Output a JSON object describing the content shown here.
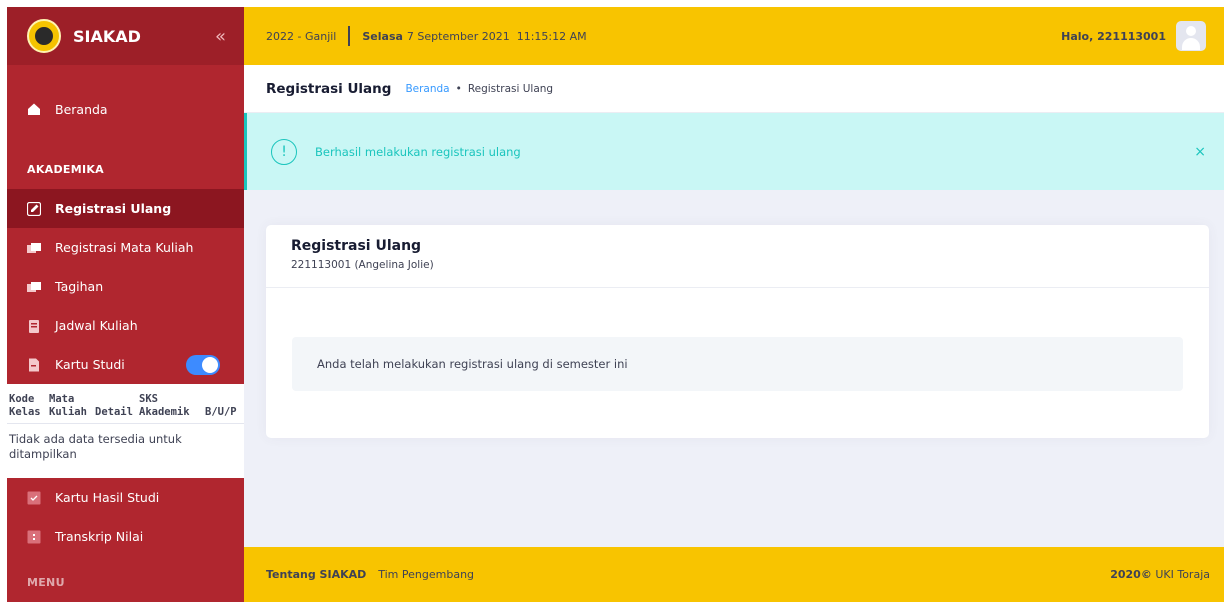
{
  "brand": {
    "name": "SIAKAD",
    "collapse_icon": "chevrons-left-icon"
  },
  "sidebar": {
    "home": {
      "label": "Beranda",
      "icon": "home-icon"
    },
    "section_akademika": "AKADEMIKA",
    "items": [
      {
        "label": "Registrasi Ulang",
        "icon": "edit-icon",
        "active": true
      },
      {
        "label": "Registrasi Mata Kuliah",
        "icon": "book-icon"
      },
      {
        "label": "Tagihan",
        "icon": "book-icon"
      },
      {
        "label": "Jadwal Kuliah",
        "icon": "clipboard-icon"
      },
      {
        "label": "Kartu Studi",
        "icon": "file-icon",
        "toggle_on": true
      },
      {
        "label": "Kartu Hasil Studi",
        "icon": "check-icon"
      },
      {
        "label": "Transkrip Nilai",
        "icon": "transcript-icon"
      }
    ],
    "studi_table": {
      "headers": [
        "Kode Kelas",
        "Mata Kuliah",
        "Detail",
        "SKS Akademik",
        "B/U/P"
      ],
      "empty": "Tidak ada data tersedia untuk ditampilkan"
    },
    "next_section": "MENU"
  },
  "topbar": {
    "semester": "2022 - Ganjil",
    "day": "Selasa",
    "datetime": "7 September 2021  11:15:12 AM",
    "greeting": "Halo, 221113001",
    "avatar_icon": "user-avatar-icon"
  },
  "subheader": {
    "title": "Registrasi Ulang",
    "breadcrumb_home": "Beranda",
    "breadcrumb_current": "Registrasi Ulang"
  },
  "alert": {
    "message": "Berhasil melakukan registrasi ulang",
    "icon": "exclamation-circle-icon",
    "close": "×"
  },
  "card": {
    "title": "Registrasi Ulang",
    "subtitle": "221113001 (Angelina Jolie)",
    "info": "Anda telah melakukan registrasi ulang di semester ini"
  },
  "footer": {
    "link_about": "Tentang SIAKAD",
    "link_team": "Tim Pengembang",
    "year": "2020©",
    "org": "UKI Toraja"
  },
  "colors": {
    "sidebar": "#b0262f",
    "accent_yellow": "#f8c400",
    "alert_bg": "#c9f7f5",
    "alert_text": "#1bc5bd",
    "link": "#3699ff"
  }
}
